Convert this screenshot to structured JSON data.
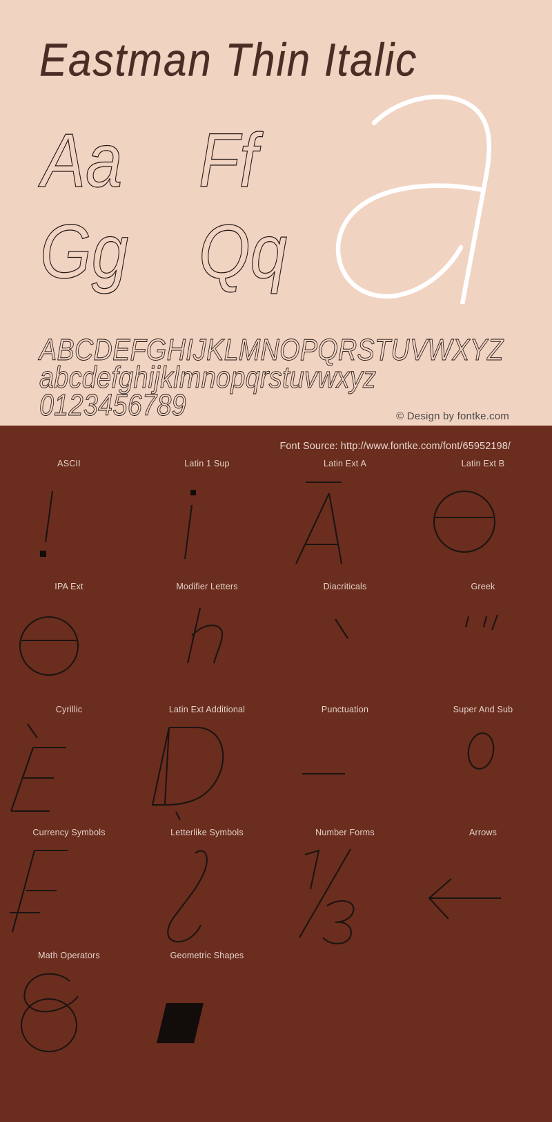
{
  "page": {
    "background_light": "#f1d3c2",
    "background_dark": "#6b2d1e",
    "ink_color": "#231815",
    "display_glyph_color": "#ffffff"
  },
  "specimen": {
    "title": "Eastman Thin Italic",
    "letter_pairs": [
      "Aa",
      "Ff",
      "Gg",
      "Qq"
    ],
    "display_glyph": "a",
    "alphabet_uppercase": "ABCDEFGHIJKLMNOPQRSTUVWXYZ",
    "alphabet_lowercase": "abcdefghijklmnopqrstuvwxyz",
    "digits": "0123456789",
    "copyright": "© Design by fontke.com"
  },
  "coverage": {
    "font_source_label": "Font Source: http://www.fontke.com/font/65952198/",
    "cells": [
      {
        "label": "ASCII",
        "sample": "!"
      },
      {
        "label": "Latin 1 Sup",
        "sample": "¡"
      },
      {
        "label": "Latin Ext A",
        "sample": "Ā"
      },
      {
        "label": "Latin Ext B",
        "sample": "ǝ"
      },
      {
        "label": "IPA Ext",
        "sample": "ə"
      },
      {
        "label": "Modifier Letters",
        "sample": "ʰ"
      },
      {
        "label": "Diacriticals",
        "sample": "̀"
      },
      {
        "label": "Greek",
        "sample": "΅"
      },
      {
        "label": "Cyrillic",
        "sample": "Ѐ"
      },
      {
        "label": "Latin Ext Additional",
        "sample": "Ḍ"
      },
      {
        "label": "Punctuation",
        "sample": "‒"
      },
      {
        "label": "Super And Sub",
        "sample": "⁰"
      },
      {
        "label": "Currency Symbols",
        "sample": "₣"
      },
      {
        "label": "Letterlike Symbols",
        "sample": "ℓ"
      },
      {
        "label": "Number Forms",
        "sample": "⅓"
      },
      {
        "label": "Arrows",
        "sample": "←"
      },
      {
        "label": "Math Operators",
        "sample": "∂"
      },
      {
        "label": "Geometric Shapes",
        "sample": "▰"
      }
    ]
  }
}
